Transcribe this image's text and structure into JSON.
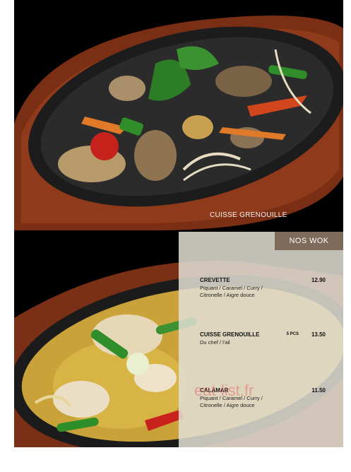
{
  "photo_top": {
    "caption": "CUISSE GRENOUILLE"
  },
  "menu": {
    "section_title": "NOS WOK",
    "items": [
      {
        "name": "CREVETTE",
        "description": "Piquant / Caramel / Curry / Citronelle / Aigre douce",
        "pieces": "",
        "price": "12.90"
      },
      {
        "name": "CUISSE GRENOUILLE",
        "description": "Du chef / l'ail",
        "pieces": "5 PCS",
        "price": "13.50"
      },
      {
        "name": "CALAMAR",
        "description": "Piquant / Caramel / Curry / Citronelle / Aigre douce",
        "pieces": "",
        "price": "11.50"
      }
    ]
  },
  "watermark": "eat-list.fr",
  "colors": {
    "tab": "#7e6a59",
    "panel": "#e1ded4",
    "background": "#000000"
  }
}
